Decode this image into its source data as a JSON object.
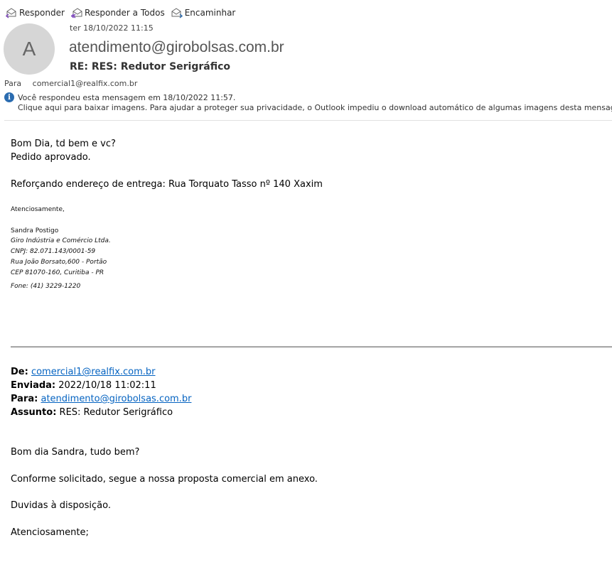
{
  "toolbar": {
    "reply": "Responder",
    "reply_all": "Responder a Todos",
    "forward": "Encaminhar"
  },
  "header": {
    "avatar_initial": "A",
    "date": "ter 18/10/2022 11:15",
    "sender": "atendimento@girobolsas.com.br",
    "subject": "RE: RES: Redutor Serigráfico",
    "to_label": "Para",
    "to_value": "comercial1@realfix.com.br",
    "info_replied": "Você respondeu esta mensagem em 18/10/2022 11:57.",
    "info_images": "Clique aqui para baixar imagens. Para ajudar a proteger sua privacidade, o Outlook impediu o download automático de algumas imagens desta mensagem."
  },
  "body": {
    "line1": "Bom Dia, td bem e vc?",
    "line2": "Pedido aprovado.",
    "line3": "Reforçando endereço de entrega: Rua Torquato Tasso nº 140 Xaxim",
    "sign_greeting": "Atenciosamente,",
    "sign_name": "Sandra Postigo",
    "sign_company": "Giro Indústria e Comércio Ltda.",
    "sign_cnpj": "CNPJ: 82.071.143/0001-59",
    "sign_address": "Rua João Borsato,600 - Portão",
    "sign_cep": "CEP 81070-160, Curitiba - PR",
    "sign_phone": "Fone:  (41) 3229-1220"
  },
  "quoted": {
    "from_label": "De:",
    "from_value": "comercial1@realfix.com.br",
    "sent_label": "Enviada:",
    "sent_value": "2022/10/18 11:02:11",
    "to_label": "Para:",
    "to_value": "atendimento@girobolsas.com.br",
    "subject_label": "Assunto:",
    "subject_value": "RES: Redutor Serigráfico",
    "line1": "Bom dia Sandra, tudo bem?",
    "line2": "Conforme solicitado, segue a nossa proposta comercial em anexo.",
    "line3": "Duvidas à disposição.",
    "line4": "Atenciosamente;"
  },
  "colors": {
    "link": "#0563c1",
    "avatar_bg": "#d6d6d6",
    "info_icon": "#2b6cb0",
    "reply_icon": "#7a3fbf",
    "forward_icon": "#2b6cb0"
  }
}
